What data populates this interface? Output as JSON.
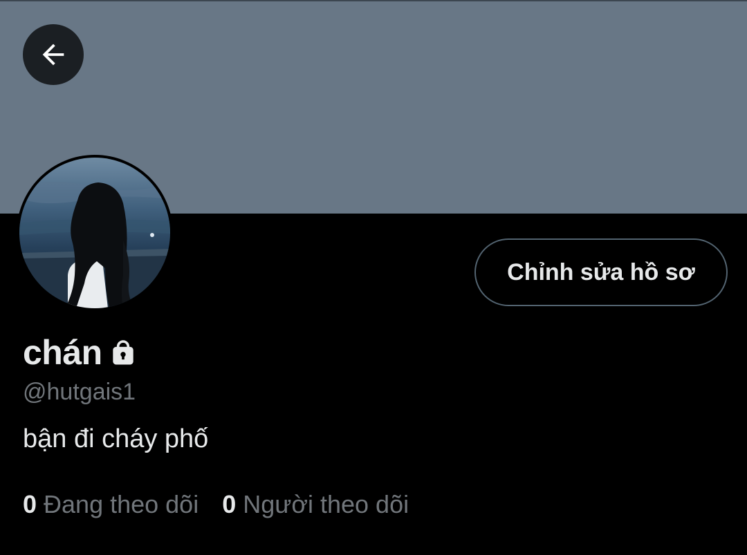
{
  "profile": {
    "display_name": "chán",
    "handle": "@hutgais1",
    "bio": "bận đi cháy phố",
    "protected_icon": "lock-icon",
    "edit_button_label": "Chỉnh sửa hồ sơ",
    "banner_color": "#687786"
  },
  "nav": {
    "back_icon": "arrow-left-icon"
  },
  "stats": {
    "following_count": "0",
    "following_label": "Đang theo dõi",
    "followers_count": "0",
    "followers_label": "Người theo dõi"
  }
}
